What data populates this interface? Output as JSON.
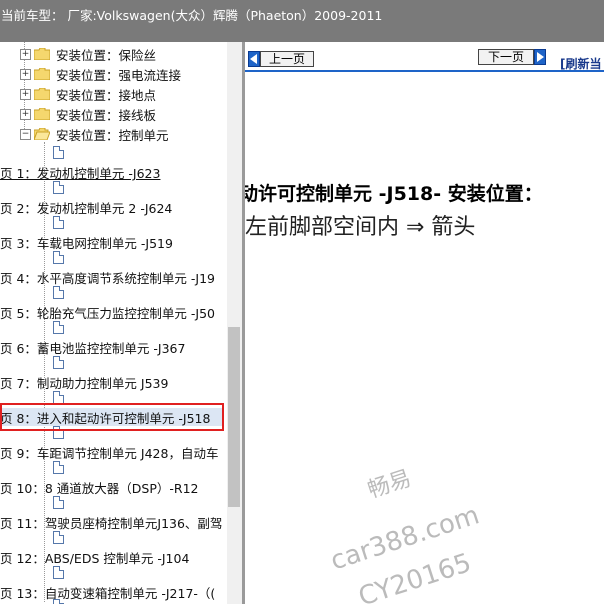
{
  "header": {
    "title": "当前车型：  厂家:Volkswagen(大众）辉腾（Phaeton）2009-2011"
  },
  "tree": {
    "folders": [
      {
        "label": "安装位置：保险丝",
        "expander": "+"
      },
      {
        "label": "安装位置：强电流连接",
        "expander": "+"
      },
      {
        "label": "安装位置：接地点",
        "expander": "+"
      },
      {
        "label": "安装位置：接线板",
        "expander": "+"
      },
      {
        "label": "安装位置：控制单元",
        "expander": "−"
      }
    ],
    "pages": [
      "页 1：发动机控制单元 -J623",
      "页 2：发动机控制单元 2 -J624",
      "页 3：车载电网控制单元 -J519",
      "页 4：水平高度调节系统控制单元 -J19",
      "页 5：轮胎充气压力监控控制单元 -J50",
      "页 6：蓄电池监控控制单元 -J367",
      "页 7：制动助力控制单元 J539",
      "页 8：进入和起动许可控制单元 -J518",
      "页 9：车距调节控制单元 J428，自动车",
      "页 10：8 通道放大器（DSP）-R12",
      "页 11：驾驶员座椅控制单元J136、副驾",
      "页 12：ABS/EDS 控制单元 -J104",
      "页 13：自动变速箱控制单元 -J217-（("
    ]
  },
  "nav": {
    "prev_label": "上一页",
    "next_label": "下一页",
    "refresh_label": "[刷新当"
  },
  "content": {
    "heading": "动许可控制单元 -J518- 安装位置：",
    "body": "左前脚部空间内 ⇒ 箭头"
  },
  "watermark": {
    "line1": "畅易",
    "line2": "car388.com",
    "line3": "CY20165"
  },
  "colors": {
    "topbar": "#7a7a7a",
    "highlight": "#e02020",
    "nav_blue": "#1e64c8",
    "folder_yellow": "#f5d76e"
  }
}
